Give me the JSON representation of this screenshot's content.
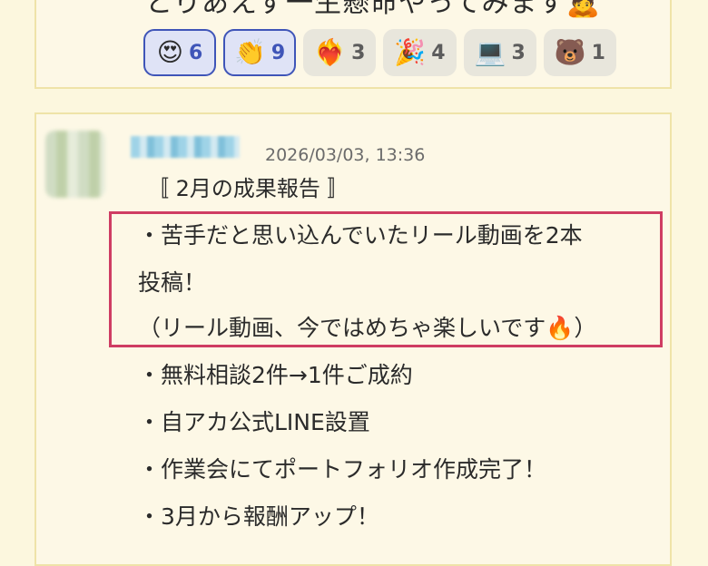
{
  "prev_comment": {
    "text": "とりあえず一生懸命やってみます🙇",
    "reactions": [
      {
        "emoji": "😍",
        "count": "6",
        "active": true
      },
      {
        "emoji": "👏",
        "count": "9",
        "active": true
      },
      {
        "emoji": "❤️‍🔥",
        "count": "3",
        "active": false
      },
      {
        "emoji": "🎉",
        "count": "4",
        "active": false
      },
      {
        "emoji": "💻",
        "count": "3",
        "active": false
      },
      {
        "emoji": "🐻",
        "count": "1",
        "active": false
      }
    ]
  },
  "comment": {
    "timestamp": "2026/03/03, 13:36",
    "heading": "〚 2月の成果報告 〛",
    "lines": [
      "・苦手だと思い込んでいたリール動画を2本",
      "投稿！",
      "（リール動画、今ではめちゃ楽しいです🔥）",
      "・無料相談2件→1件ご成約",
      "・自アカ公式LINE設置",
      "・作業会にてポートフォリオ作成完了！",
      "・3月から報酬アップ！"
    ]
  },
  "colors": {
    "page_bg": "#fcf7de",
    "card_border": "#efe3a8",
    "active_reaction": "#3f55b8",
    "highlight_border": "#cf3d63"
  }
}
